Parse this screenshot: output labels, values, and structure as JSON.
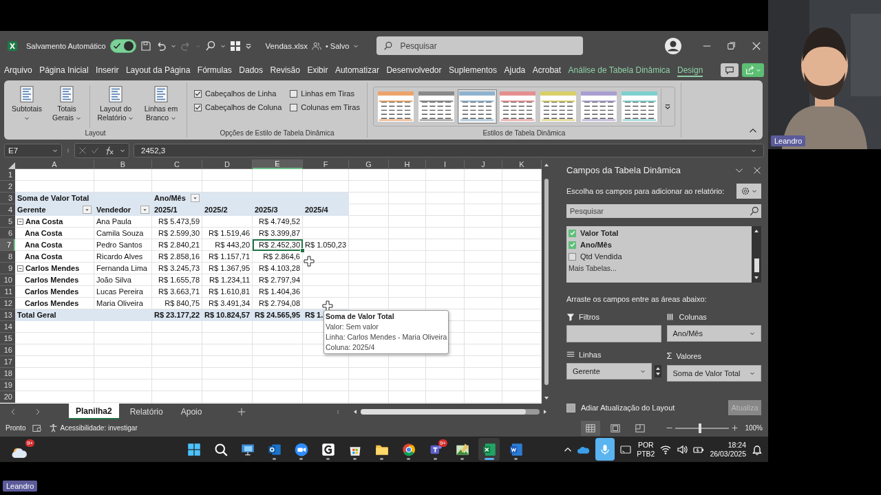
{
  "title_bar": {
    "autosave_label": "Salvamento Automático",
    "autosave_on": true,
    "file_name": "Vendas.xlsx",
    "save_status": "• Salvo",
    "search_placeholder": "Pesquisar"
  },
  "menu_tabs": [
    {
      "label": "Arquivo",
      "kind": "normal",
      "selected": false
    },
    {
      "label": "Página Inicial",
      "kind": "normal",
      "selected": false
    },
    {
      "label": "Inserir",
      "kind": "normal",
      "selected": false
    },
    {
      "label": "Layout da Página",
      "kind": "normal",
      "selected": false
    },
    {
      "label": "Fórmulas",
      "kind": "normal",
      "selected": false
    },
    {
      "label": "Dados",
      "kind": "normal",
      "selected": false
    },
    {
      "label": "Revisão",
      "kind": "normal",
      "selected": false
    },
    {
      "label": "Exibir",
      "kind": "normal",
      "selected": false
    },
    {
      "label": "Automatizar",
      "kind": "normal",
      "selected": false
    },
    {
      "label": "Desenvolvedor",
      "kind": "normal",
      "selected": false
    },
    {
      "label": "Suplementos",
      "kind": "normal",
      "selected": false
    },
    {
      "label": "Ajuda",
      "kind": "normal",
      "selected": false
    },
    {
      "label": "Acrobat",
      "kind": "normal",
      "selected": false
    },
    {
      "label": "Análise de Tabela Dinâmica",
      "kind": "contextual",
      "selected": false
    },
    {
      "label": "Design",
      "kind": "contextual",
      "selected": true
    }
  ],
  "ribbon": {
    "layout_group": {
      "label": "Layout",
      "buttons": [
        "Subtotais",
        "Totais Gerais",
        "Layout do Relatório",
        "Linhas em Branco"
      ]
    },
    "options_group": {
      "label": "Opções de Estilo de Tabela Dinâmica",
      "options": [
        {
          "label": "Cabeçalhos de Linha",
          "checked": true
        },
        {
          "label": "Linhas em Tiras",
          "checked": false
        },
        {
          "label": "Cabeçalhos de Coluna",
          "checked": true
        },
        {
          "label": "Colunas em Tiras",
          "checked": false
        }
      ]
    },
    "styles_group": {
      "label": "Estilos de Tabela Dinâmica",
      "styles": [
        {
          "color": "#eaa46c",
          "selected": false
        },
        {
          "color": "#8a8a8a",
          "selected": false
        },
        {
          "color": "#8fb3cf",
          "selected": true
        },
        {
          "color": "#e58f8f",
          "selected": false
        },
        {
          "color": "#d9cf6a",
          "selected": false
        },
        {
          "color": "#a99fd0",
          "selected": false
        },
        {
          "color": "#7fcfcf",
          "selected": false
        }
      ]
    }
  },
  "formula_bar": {
    "name_box": "E7",
    "formula": "2452,3"
  },
  "sheet": {
    "columns": [
      {
        "label": "A",
        "selected": false
      },
      {
        "label": "B",
        "selected": false
      },
      {
        "label": "C",
        "selected": false
      },
      {
        "label": "D",
        "selected": false
      },
      {
        "label": "E",
        "selected": true
      },
      {
        "label": "F",
        "selected": false
      },
      {
        "label": "G",
        "selected": false
      },
      {
        "label": "H",
        "selected": false
      },
      {
        "label": "I",
        "selected": false
      },
      {
        "label": "J",
        "selected": false
      },
      {
        "label": "K",
        "selected": false
      }
    ],
    "row_numbers": [
      {
        "label": "1",
        "selected": false
      },
      {
        "label": "2",
        "selected": false
      },
      {
        "label": "3",
        "selected": false
      },
      {
        "label": "4",
        "selected": false
      },
      {
        "label": "5",
        "selected": false
      },
      {
        "label": "6",
        "selected": false
      },
      {
        "label": "7",
        "selected": true
      },
      {
        "label": "8",
        "selected": false
      },
      {
        "label": "9",
        "selected": false
      },
      {
        "label": "10",
        "selected": false
      },
      {
        "label": "11",
        "selected": false
      },
      {
        "label": "12",
        "selected": false
      },
      {
        "label": "13",
        "selected": false
      },
      {
        "label": "14",
        "selected": false
      },
      {
        "label": "15",
        "selected": false
      },
      {
        "label": "16",
        "selected": false
      },
      {
        "label": "17",
        "selected": false
      },
      {
        "label": "18",
        "selected": false
      },
      {
        "label": "19",
        "selected": false
      },
      {
        "label": "20",
        "selected": false
      }
    ],
    "pivot": {
      "title": "Soma de Valor Total",
      "column_field": "Ano/Mês",
      "row_fields": [
        "Gerente",
        "Vendedor"
      ],
      "columns": [
        "2025/1",
        "2025/2",
        "2025/3",
        "2025/4"
      ],
      "rows": [
        {
          "kind": "group",
          "manager": "Ana Costa",
          "seller": "Ana Paula",
          "values": [
            {
              "kind": "value",
              "text": "R$ 5.473,59"
            },
            {
              "kind": "empty"
            },
            {
              "kind": "value",
              "text": "R$ 4.749,52"
            },
            {
              "kind": "empty"
            }
          ]
        },
        {
          "kind": "repeat",
          "manager": "Ana Costa",
          "seller": "Camila Souza",
          "values": [
            {
              "kind": "value",
              "text": "R$ 2.599,30"
            },
            {
              "kind": "value",
              "text": "R$ 1.519,46"
            },
            {
              "kind": "value",
              "text": "R$ 3.399,87"
            },
            {
              "kind": "empty"
            }
          ]
        },
        {
          "kind": "repeat",
          "manager": "Ana Costa",
          "seller": "Pedro Santos",
          "values": [
            {
              "kind": "value",
              "text": "R$ 2.840,21"
            },
            {
              "kind": "value",
              "text": "R$ 443,20"
            },
            {
              "kind": "value",
              "text": "R$ 2.452,30"
            },
            {
              "kind": "value",
              "text": "R$ 1.050,23"
            }
          ]
        },
        {
          "kind": "repeat",
          "manager": "Ana Costa",
          "seller": "Ricardo Alves",
          "values": [
            {
              "kind": "value",
              "text": "R$ 2.858,16"
            },
            {
              "kind": "value",
              "text": "R$ 1.157,71"
            },
            {
              "kind": "value",
              "text": "R$ 2.864,6"
            },
            {
              "kind": "empty"
            }
          ]
        },
        {
          "kind": "group",
          "manager": "Carlos Mendes",
          "seller": "Fernanda Lima",
          "values": [
            {
              "kind": "value",
              "text": "R$ 3.245,73"
            },
            {
              "kind": "value",
              "text": "R$ 1.367,95"
            },
            {
              "kind": "value",
              "text": "R$ 4.103,28"
            },
            {
              "kind": "empty"
            }
          ]
        },
        {
          "kind": "repeat",
          "manager": "Carlos Mendes",
          "seller": "João Silva",
          "values": [
            {
              "kind": "value",
              "text": "R$ 1.655,78"
            },
            {
              "kind": "value",
              "text": "R$ 1.234,11"
            },
            {
              "kind": "value",
              "text": "R$ 2.797,94"
            },
            {
              "kind": "empty"
            }
          ]
        },
        {
          "kind": "repeat",
          "manager": "Carlos Mendes",
          "seller": "Lucas Pereira",
          "values": [
            {
              "kind": "value",
              "text": "R$ 3.663,71"
            },
            {
              "kind": "value",
              "text": "R$ 1.610,81"
            },
            {
              "kind": "value",
              "text": "R$ 1.404,36"
            },
            {
              "kind": "empty"
            }
          ]
        },
        {
          "kind": "repeat",
          "manager": "Carlos Mendes",
          "seller": "Maria Oliveira",
          "values": [
            {
              "kind": "value",
              "text": "R$ 840,75"
            },
            {
              "kind": "value",
              "text": "R$ 3.491,34"
            },
            {
              "kind": "value",
              "text": "R$ 2.794,08"
            },
            {
              "kind": "empty"
            }
          ]
        }
      ],
      "total": {
        "label": "Total Geral",
        "values": [
          "R$ 23.177,22",
          "R$ 10.824,57",
          "R$ 24.565,95",
          "R$ 1."
        ]
      }
    },
    "tooltip": {
      "title": "Soma de Valor Total",
      "lines": [
        "Valor: Sem valor",
        "Linha: Carlos Mendes - Maria Oliveira",
        "Coluna: 2025/4"
      ]
    },
    "tabs": [
      {
        "label": "Planilha2",
        "selected": true
      },
      {
        "label": "Relatório",
        "selected": false
      },
      {
        "label": "Apoio",
        "selected": false
      }
    ]
  },
  "pane": {
    "title": "Campos da Tabela Dinâmica",
    "instruction": "Escolha os campos para adicionar ao relatório:",
    "search_placeholder": "Pesquisar",
    "fields": [
      {
        "label": "Valor Total",
        "checked": true
      },
      {
        "label": "Ano/Mês",
        "checked": true
      },
      {
        "label": "Qtd Vendida",
        "checked": false
      }
    ],
    "more_tables": "Mais Tabelas...",
    "drag_hint": "Arraste os campos entre as áreas abaixo:",
    "areas": [
      {
        "kind": "filters",
        "label": "Filtros"
      },
      {
        "kind": "columns",
        "label": "Colunas",
        "field": "Ano/Mês"
      },
      {
        "kind": "rows",
        "label": "Linhas",
        "field": "Gerente"
      },
      {
        "kind": "values",
        "label": "Valores",
        "symbol": "Σ",
        "field": "Soma de Valor Total"
      }
    ],
    "defer_label": "Adiar Atualização do Layout",
    "defer_checked": false,
    "update_button": "Atualiza"
  },
  "status_bar": {
    "status": "Pronto",
    "accessibility": "Acessibilidade: investigar",
    "views": [
      {
        "kind": "normal",
        "selected": true
      },
      {
        "kind": "page_layout",
        "selected": false
      },
      {
        "kind": "page_break",
        "selected": false
      }
    ],
    "zoom": {
      "level": 0.45,
      "label": "100%"
    }
  },
  "taskbar": {
    "weather_badge": "9+",
    "apps": [
      {
        "kind": "start",
        "selected": false
      },
      {
        "kind": "search",
        "selected": false
      },
      {
        "kind": "taskview",
        "selected": false
      },
      {
        "kind": "outlook",
        "selected": false
      },
      {
        "kind": "zoom",
        "selected": false
      },
      {
        "kind": "gapp",
        "selected": false
      },
      {
        "kind": "store",
        "selected": false
      },
      {
        "kind": "folder",
        "selected": false
      },
      {
        "kind": "chrome",
        "selected": false
      },
      {
        "kind": "teams",
        "selected": false,
        "badge": "9+"
      },
      {
        "kind": "photos",
        "selected": false
      },
      {
        "kind": "excel",
        "selected": true
      },
      {
        "kind": "word",
        "selected": false
      }
    ],
    "language": [
      "POR",
      "PTB2"
    ],
    "time": "18:24",
    "date": "26/03/2025"
  },
  "webcam": {
    "name": "Leandro"
  },
  "footer_label": "Leandro"
}
